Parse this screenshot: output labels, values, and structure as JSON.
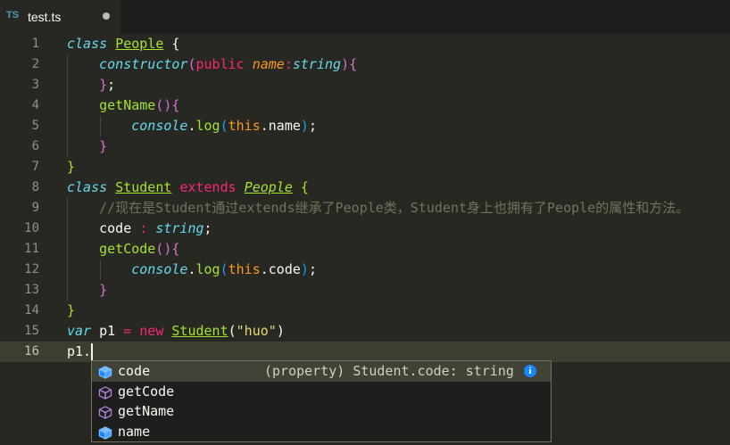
{
  "tab": {
    "lang_badge": "TS",
    "file_name": "test.ts"
  },
  "editor": {
    "current_line": 16,
    "lines": [
      {
        "n": "1",
        "tokens": [
          [
            "kw",
            "class"
          ],
          [
            "",
            ""
          ],
          [
            " ",
            " "
          ],
          [
            "cls",
            "People"
          ],
          [
            "",
            " "
          ],
          [
            "br1",
            "{"
          ]
        ]
      },
      {
        "n": "2",
        "tokens": [
          [
            "",
            "    "
          ],
          [
            "param2",
            "constructor"
          ],
          [
            "br2",
            "("
          ],
          [
            "pink",
            "public"
          ],
          [
            "",
            " "
          ],
          [
            "param",
            "name"
          ],
          [
            "pink",
            ":"
          ],
          [
            "type",
            "string"
          ],
          [
            "br2",
            ")"
          ],
          [
            "br2",
            "{"
          ]
        ]
      },
      {
        "n": "3",
        "tokens": [
          [
            "",
            "    "
          ],
          [
            "br2",
            "}"
          ],
          [
            "",
            ";"
          ]
        ]
      },
      {
        "n": "4",
        "tokens": [
          [
            "",
            "    "
          ],
          [
            "fn",
            "getName"
          ],
          [
            "br2",
            "()"
          ],
          [
            "br2",
            "{"
          ]
        ]
      },
      {
        "n": "5",
        "tokens": [
          [
            "",
            "        "
          ],
          [
            "kw",
            "console"
          ],
          [
            "",
            "."
          ],
          [
            "fn",
            "log"
          ],
          [
            "br3",
            "("
          ],
          [
            "this",
            "this"
          ],
          [
            "",
            ".name"
          ],
          [
            "br3",
            ")"
          ],
          [
            "",
            ";"
          ]
        ]
      },
      {
        "n": "6",
        "tokens": [
          [
            "",
            "    "
          ],
          [
            "br2",
            "}"
          ]
        ]
      },
      {
        "n": "7",
        "tokens": [
          [
            "fn",
            "}"
          ]
        ]
      },
      {
        "n": "8",
        "tokens": [
          [
            "kw",
            "class"
          ],
          [
            "",
            " "
          ],
          [
            "cls",
            "Student"
          ],
          [
            "",
            " "
          ],
          [
            "pink",
            "extends"
          ],
          [
            "",
            " "
          ],
          [
            "clsi",
            "People"
          ],
          [
            "",
            " "
          ],
          [
            "fn",
            "{"
          ]
        ]
      },
      {
        "n": "9",
        "tokens": [
          [
            "",
            "    "
          ],
          [
            "cmt",
            "//现在是Student通过extends继承了People类，Student身上也拥有了People的属性和方法。"
          ]
        ]
      },
      {
        "n": "10",
        "tokens": [
          [
            "",
            "    code "
          ],
          [
            "pink",
            ":"
          ],
          [
            "",
            " "
          ],
          [
            "type",
            "string"
          ],
          [
            "",
            ";"
          ]
        ]
      },
      {
        "n": "11",
        "tokens": [
          [
            "",
            "    "
          ],
          [
            "fn",
            "getCode"
          ],
          [
            "br2",
            "()"
          ],
          [
            "br2",
            "{"
          ]
        ]
      },
      {
        "n": "12",
        "tokens": [
          [
            "",
            "        "
          ],
          [
            "kw",
            "console"
          ],
          [
            "",
            "."
          ],
          [
            "fn",
            "log"
          ],
          [
            "br3",
            "("
          ],
          [
            "this",
            "this"
          ],
          [
            "",
            ".code"
          ],
          [
            "br3",
            ")"
          ],
          [
            "",
            ";"
          ]
        ]
      },
      {
        "n": "13",
        "tokens": [
          [
            "",
            "    "
          ],
          [
            "br2",
            "}"
          ]
        ]
      },
      {
        "n": "14",
        "tokens": [
          [
            "fn",
            "}"
          ]
        ]
      },
      {
        "n": "15",
        "tokens": [
          [
            "kw",
            "var"
          ],
          [
            "",
            " p1 "
          ],
          [
            "pink",
            "="
          ],
          [
            "",
            " "
          ],
          [
            "pink",
            "new"
          ],
          [
            "",
            " "
          ],
          [
            "cls",
            "Student"
          ],
          [
            "br1",
            "("
          ],
          [
            "str",
            "\"huo\""
          ],
          [
            "br1",
            ")"
          ]
        ]
      },
      {
        "n": "16",
        "tokens": [
          [
            "",
            "p1."
          ]
        ]
      }
    ]
  },
  "suggest": {
    "items": [
      {
        "label": "code",
        "kind": "field",
        "detail": "(property) Student.code: string",
        "selected": true
      },
      {
        "label": "getCode",
        "kind": "method",
        "detail": "",
        "selected": false
      },
      {
        "label": "getName",
        "kind": "method",
        "detail": "",
        "selected": false
      },
      {
        "label": "name",
        "kind": "field",
        "detail": "",
        "selected": false
      }
    ],
    "info_glyph": "i"
  },
  "icons": {
    "field": "field-cube-icon",
    "method": "method-cube-icon"
  },
  "colors": {
    "background": "#272822",
    "keyword": "#66d9ef",
    "class": "#a6e22e",
    "pink": "#f92672",
    "param": "#fd971f",
    "comment": "#75715e",
    "string": "#e6db74",
    "icon_blue": "#519aba"
  }
}
